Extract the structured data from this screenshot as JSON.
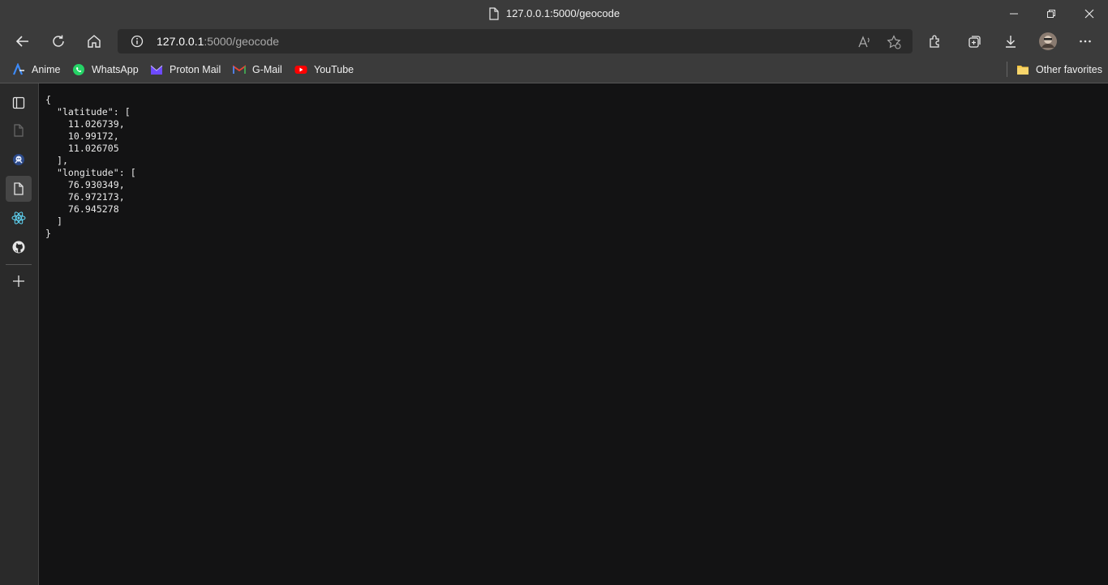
{
  "window": {
    "title": "127.0.0.1:5000/geocode"
  },
  "address_bar": {
    "host": "127.0.0.1",
    "path": ":5000/geocode"
  },
  "bookmarks": [
    {
      "label": "Anime",
      "icon": "anime-icon"
    },
    {
      "label": "WhatsApp",
      "icon": "whatsapp-icon"
    },
    {
      "label": "Proton Mail",
      "icon": "proton-mail-icon"
    },
    {
      "label": "G-Mail",
      "icon": "gmail-icon"
    },
    {
      "label": "YouTube",
      "icon": "youtube-icon"
    }
  ],
  "other_favorites": "Other favorites",
  "sidebar_icons": [
    "tab-actions-icon",
    "page-icon",
    "extension-icon",
    "page-icon-active",
    "react-icon",
    "github-icon",
    "add-icon"
  ],
  "page": {
    "json_text": "{\n  \"latitude\": [\n    11.026739,\n    10.99172,\n    11.026705\n  ],\n  \"longitude\": [\n    76.930349,\n    76.972173,\n    76.945278\n  ]\n}"
  },
  "colors": {
    "chrome": "#3b3b3b",
    "page_background": "#131314",
    "accent": "#ffffff"
  }
}
